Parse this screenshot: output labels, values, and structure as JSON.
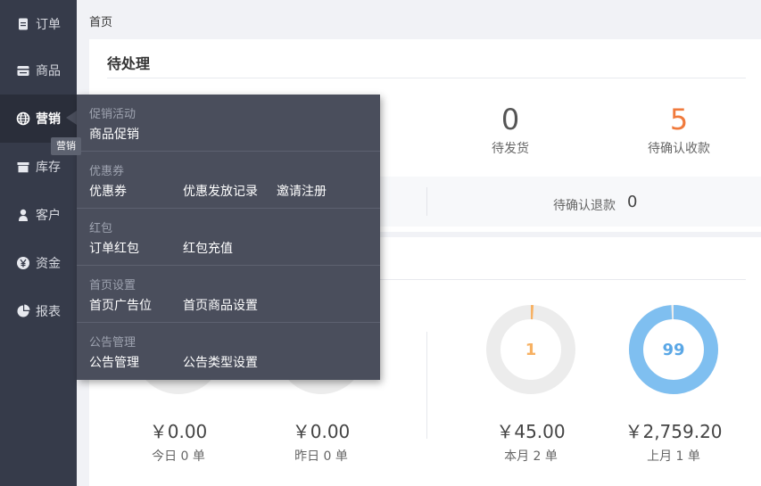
{
  "sidebar": {
    "items": [
      {
        "label": "订单",
        "icon": "document-icon"
      },
      {
        "label": "商品",
        "icon": "store-icon"
      },
      {
        "label": "营销",
        "icon": "globe-icon"
      },
      {
        "label": "库存",
        "icon": "box-icon"
      },
      {
        "label": "客户",
        "icon": "user-icon"
      },
      {
        "label": "资金",
        "icon": "yen-icon"
      },
      {
        "label": "报表",
        "icon": "pie-chart-icon"
      }
    ],
    "active_index": 2,
    "tooltip": "营销"
  },
  "breadcrumb": "首页",
  "pending": {
    "title": "待处理",
    "stats": [
      {
        "value": "0",
        "label": "待发货"
      },
      {
        "value": "5",
        "label": "待确认收款"
      }
    ],
    "refund_label": "待确认退款",
    "refund_value": "0"
  },
  "sales": {
    "items": [
      {
        "amount": "￥0.00",
        "sub": "今日 0 单"
      },
      {
        "amount": "￥0.00",
        "sub": "昨日 0 单"
      },
      {
        "amount": "￥45.00",
        "sub": "本月 2 单",
        "count": "1",
        "ratio": 0.01
      },
      {
        "amount": "￥2,759.20",
        "sub": "上月 1 单",
        "count": "99",
        "ratio": 0.99
      }
    ]
  },
  "dropdown": {
    "groups": [
      {
        "title": "促销活动",
        "links": [
          "商品促销"
        ]
      },
      {
        "title": "优惠券",
        "links": [
          "优惠券",
          "优惠发放记录",
          "邀请注册"
        ]
      },
      {
        "title": "红包",
        "links": [
          "订单红包",
          "红包充值"
        ]
      },
      {
        "title": "首页设置",
        "links": [
          "首页广告位",
          "首页商品设置"
        ]
      },
      {
        "title": "公告管理",
        "links": [
          "公告管理",
          "公告类型设置"
        ]
      }
    ]
  },
  "colors": {
    "sidebar_bg": "#363b4a",
    "orange": "#f07a3c",
    "donut_orange": "#f7b163",
    "donut_blue": "#7fbff0",
    "donut_track": "#ececec"
  }
}
